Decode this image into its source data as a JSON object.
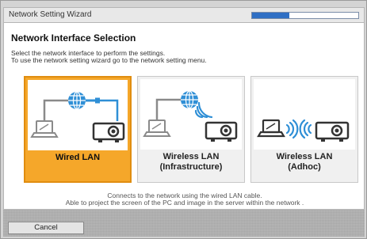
{
  "window": {
    "title": "Network Setting Wizard",
    "progress_fraction": 0.35,
    "accent": "#2f6fc4"
  },
  "page": {
    "heading": "Network Interface Selection",
    "description": [
      "Select the network interface to perform the settings.",
      "To use the network setting wizard go to the network setting menu."
    ]
  },
  "options": [
    {
      "label_line1": "Wired LAN",
      "label_line2": "",
      "selected": true,
      "icon": "wired-lan-icon"
    },
    {
      "label_line1": "Wireless LAN",
      "label_line2": "(Infrastructure)",
      "selected": false,
      "icon": "wireless-infrastructure-icon"
    },
    {
      "label_line1": "Wireless LAN",
      "label_line2": "(Adhoc)",
      "selected": false,
      "icon": "wireless-adhoc-icon"
    }
  ],
  "hint": [
    "Connects to the network using the wired LAN cable.",
    "Able to project the screen of the PC and image in the server within the network ."
  ],
  "footer": {
    "cancel_label": "Cancel"
  },
  "colors": {
    "selected_card": "#f5a72a",
    "globe": "#2f8fd6",
    "icon_gray": "#8a8a8a"
  }
}
